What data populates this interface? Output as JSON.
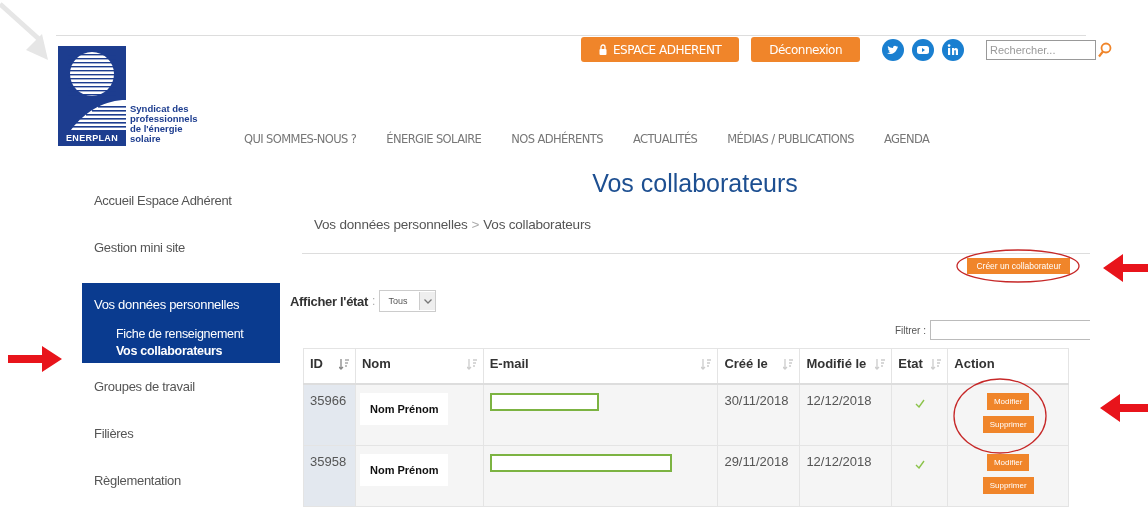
{
  "logo": {
    "badge": "ENERPLAN",
    "tagline": "Syndicat des professionnels de l'énergie solaire"
  },
  "top_buttons": [
    {
      "label": "ESPACE ADHERENT",
      "kind": "lock"
    },
    {
      "label": "Déconnexion",
      "kind": "plain"
    }
  ],
  "search": {
    "placeholder": "Rechercher..."
  },
  "nav": [
    "QUI SOMMES-NOUS ?",
    "ÉNERGIE SOLAIRE",
    "NOS ADHÉRENTS",
    "ACTUALITÉS",
    "MÉDIAS / PUBLICATIONS",
    "AGENDA"
  ],
  "sidebar": {
    "items": [
      {
        "label": "Accueil Espace Adhérent",
        "selected": false
      },
      {
        "label": "Gestion mini site",
        "selected": false
      },
      {
        "label": "Vos données personnelles",
        "selected": true,
        "children": [
          {
            "label": "Fiche de renseignement",
            "selected": false
          },
          {
            "label": "Vos collaborateurs",
            "selected": true
          }
        ]
      },
      {
        "label": "Groupes de travail",
        "selected": false
      },
      {
        "label": "Filières",
        "selected": false
      },
      {
        "label": "Règlementation",
        "selected": false
      }
    ]
  },
  "page_title": "Vos collaborateurs",
  "breadcrumb": {
    "items": [
      "Vos données personnelles",
      "Vos collaborateurs"
    ],
    "separator": ">"
  },
  "create_button": "Créer un collaborateur",
  "state_filter": {
    "label": "Afficher l'état",
    "colon": ":",
    "value": "Tous"
  },
  "filter": {
    "label": "Filtrer :"
  },
  "table": {
    "columns": [
      {
        "label": "ID",
        "sortable": true,
        "sorted": true
      },
      {
        "label": "Nom",
        "sortable": true,
        "sorted": false
      },
      {
        "label": "E-mail",
        "sortable": true,
        "sorted": false
      },
      {
        "label": "Créé le",
        "sortable": true,
        "sorted": false
      },
      {
        "label": "Modifié le",
        "sortable": true,
        "sorted": false
      },
      {
        "label": "Etat",
        "sortable": true,
        "sorted": false
      },
      {
        "label": "Action",
        "sortable": false
      }
    ],
    "rows": [
      {
        "id": "35966",
        "name": "Nom Prénom",
        "created": "30/11/2018",
        "modified": "12/12/2018",
        "active": true,
        "actions": [
          "Modifier",
          "Supprimer"
        ]
      },
      {
        "id": "35958",
        "name": "Nom Prénom",
        "created": "29/11/2018",
        "modified": "12/12/2018",
        "active": true,
        "actions": [
          "Modifier",
          "Supprimer"
        ]
      }
    ]
  }
}
